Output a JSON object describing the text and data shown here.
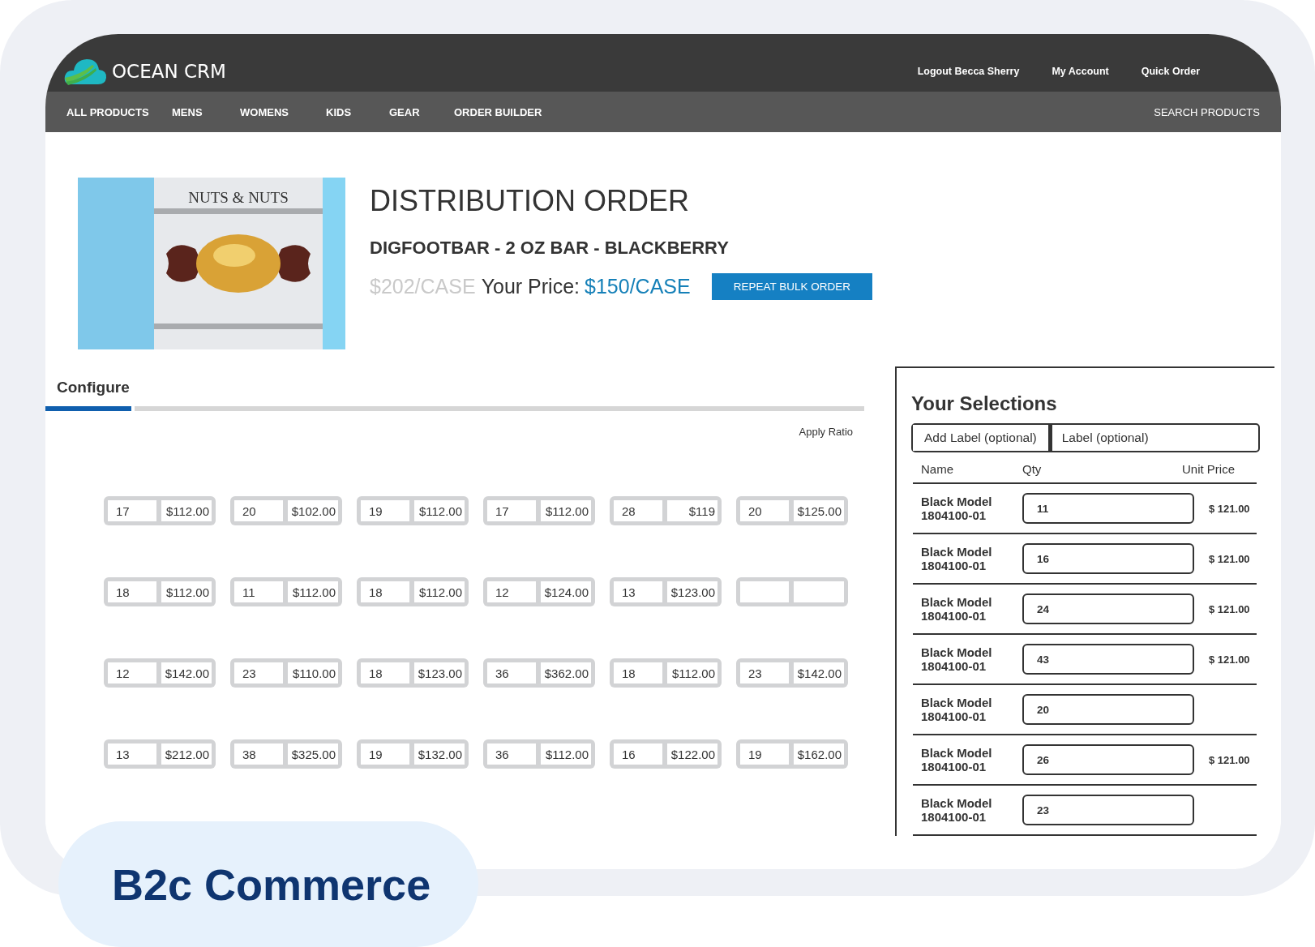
{
  "header": {
    "brand": "OCEAN CRM",
    "links": [
      "Logout Becca Sherry",
      "My Account",
      "Quick Order"
    ]
  },
  "nav": {
    "items": [
      "ALL PRODUCTS",
      "MENS",
      "WOMENS",
      "KIDS",
      "GEAR",
      "ORDER BUILDER"
    ],
    "search": "SEARCH PRODUCTS"
  },
  "product": {
    "box_label": "NUTS & NUTS",
    "title": "DISTRIBUTION ORDER",
    "name": "DIGFOOTBAR - 2 OZ BAR - BLACKBERRY",
    "old_price": "$202/CASE",
    "price_label": "Your Price:",
    "price": "$150/CASE",
    "button": "REPEAT BULK ORDER"
  },
  "configure": {
    "tabs": [
      {
        "label": "Configure",
        "selected": true
      }
    ],
    "apply": "Apply Ratio",
    "rows": [
      [
        {
          "qty": "17",
          "price": "$112.00"
        },
        {
          "qty": "20",
          "price": "$102.00"
        },
        {
          "qty": "19",
          "price": "$112.00"
        },
        {
          "qty": "17",
          "price": "$112.00"
        },
        {
          "qty": "28",
          "price": "$119"
        },
        {
          "qty": "20",
          "price": "$125.00"
        }
      ],
      [
        {
          "qty": "18",
          "price": "$112.00"
        },
        {
          "qty": "11",
          "price": "$112.00"
        },
        {
          "qty": "18",
          "price": "$112.00"
        },
        {
          "qty": "12",
          "price": "$124.00"
        },
        {
          "qty": "13",
          "price": "$123.00"
        },
        {}
      ],
      [
        {
          "qty": "12",
          "price": "$142.00"
        },
        {
          "qty": "23",
          "price": "$110.00"
        },
        {
          "qty": "18",
          "price": "$123.00"
        },
        {
          "qty": "36",
          "price": "$362.00"
        },
        {
          "qty": "18",
          "price": "$112.00"
        },
        {
          "qty": "23",
          "price": "$142.00"
        }
      ],
      [
        {
          "qty": "13",
          "price": "$212.00"
        },
        {
          "qty": "38",
          "price": "$325.00"
        },
        {
          "qty": "19",
          "price": "$132.00"
        },
        {
          "qty": "36",
          "price": "$112.00"
        },
        {
          "qty": "16",
          "price": "$122.00"
        },
        {
          "qty": "19",
          "price": "$162.00"
        }
      ]
    ]
  },
  "selections": {
    "title": "Your Selections",
    "label_button": "Add Label (optional)",
    "label_placeholder": "Label (optional)",
    "columns": [
      "Name",
      "Qty",
      "Unit Price"
    ],
    "rows": [
      {
        "name": "Black Model 1804100-01",
        "qty": "11",
        "unit_price": "$ 121.00"
      },
      {
        "name": "Black Model 1804100-01",
        "qty": "16",
        "unit_price": "$ 121.00"
      },
      {
        "name": "Black Model 1804100-01",
        "qty": "24",
        "unit_price": "$ 121.00"
      },
      {
        "name": "Black Model 1804100-01",
        "qty": "43",
        "unit_price": "$ 121.00"
      },
      {
        "name": "Black Model 1804100-01",
        "qty": "20"
      },
      {
        "name": "Black Model 1804100-01",
        "qty": "26",
        "unit_price": "$ 121.00"
      },
      {
        "name": "Black Model 1804100-01",
        "qty": "23"
      }
    ]
  },
  "badge": {
    "text": "B2c Commerce"
  }
}
